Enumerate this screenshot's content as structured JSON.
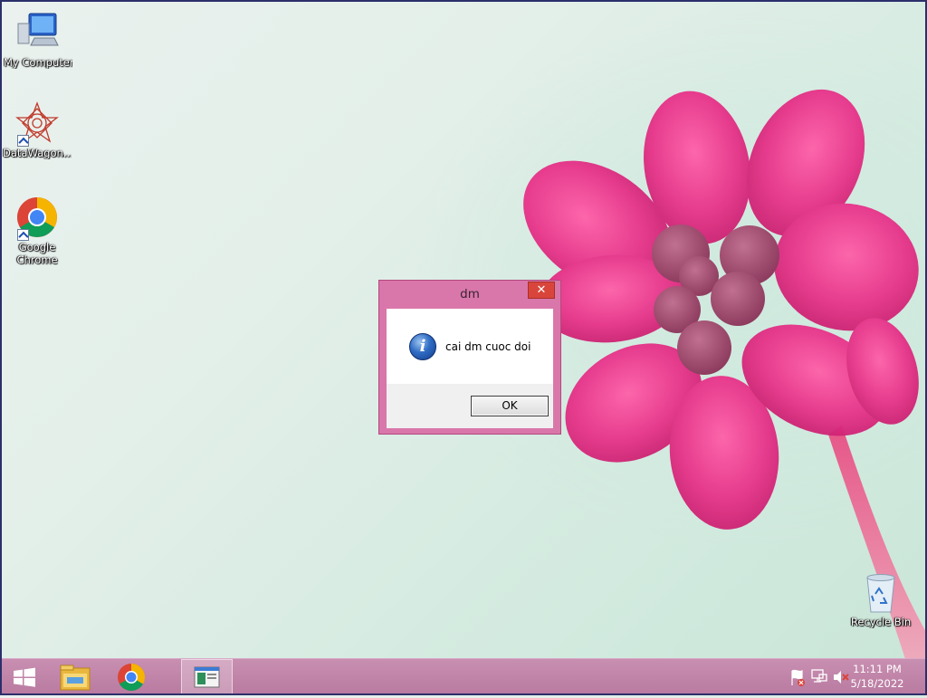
{
  "desktop": {
    "icons": [
      {
        "label": "My Computer",
        "icon": "my-computer-icon"
      },
      {
        "label": "DataWagon...",
        "icon": "datawagon-icon"
      },
      {
        "label": "Google Chrome",
        "icon": "chrome-icon"
      },
      {
        "label": "Recycle Bin",
        "icon": "recycle-bin-icon"
      }
    ]
  },
  "dialog": {
    "title": "dm",
    "close_label": "✕",
    "message": "cai dm cuoc doi",
    "icon_glyph": "i",
    "ok_label": "OK"
  },
  "taskbar": {
    "clock_time": "11:11 PM",
    "clock_date": "5/18/2022",
    "pinned": [
      "start-icon",
      "file-explorer-icon",
      "chrome-icon",
      "active-app-icon"
    ],
    "tray_icons": [
      "action-center-flag-icon",
      "network-icon",
      "volume-muted-icon"
    ]
  },
  "colors": {
    "dialog_frame": "#d977aa",
    "close_button": "#d9453b",
    "taskbar": "#c88fb1"
  }
}
